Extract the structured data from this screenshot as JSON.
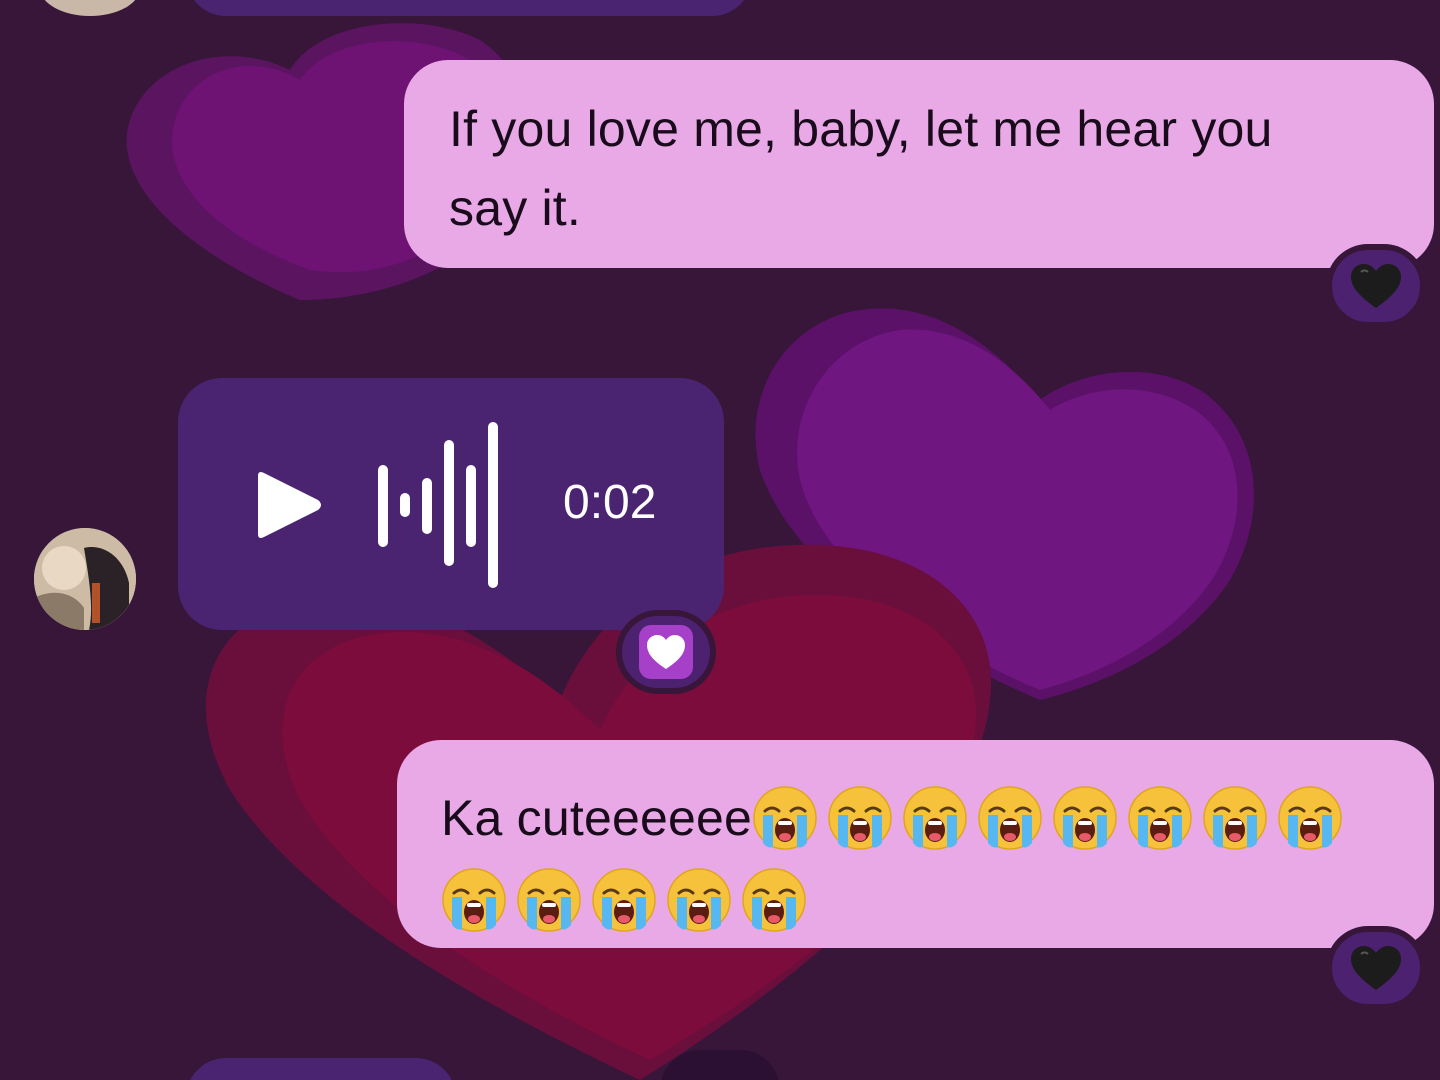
{
  "conversation": {
    "messages": [
      {
        "direction": "outgoing",
        "type": "text",
        "text_line1": "If you love me, baby, let me hear you",
        "text_line2": "say it.",
        "reaction": "black-heart"
      },
      {
        "direction": "incoming",
        "type": "voice",
        "duration": "0:02",
        "reaction": "purple-heart"
      },
      {
        "direction": "outgoing",
        "type": "text",
        "text": "Ka cuteeeeee",
        "emoji": "loudly-crying-face",
        "emoji_count": 13,
        "reaction": "black-heart"
      }
    ]
  },
  "colors": {
    "background": "#37163a",
    "outgoing_bubble": "#e8a9e6",
    "incoming_bubble": "#4a2470",
    "heart_purple": "#6e1274",
    "heart_red": "#7a0c3a"
  }
}
